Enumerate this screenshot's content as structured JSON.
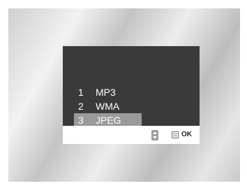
{
  "menu": {
    "items": [
      {
        "number": "1",
        "label": "MP3",
        "selected": false
      },
      {
        "number": "2",
        "label": "WMA",
        "selected": false
      },
      {
        "number": "3",
        "label": "JPEG",
        "selected": true
      }
    ]
  },
  "footer": {
    "navigate_icon": "up-down-arrows-icon",
    "enter_icon": "enter-icon",
    "ok_label": "OK"
  },
  "colors": {
    "screen_bg": "#3a3a3a",
    "selection_bg": "#9a9a9a",
    "text": "#ffffff"
  }
}
